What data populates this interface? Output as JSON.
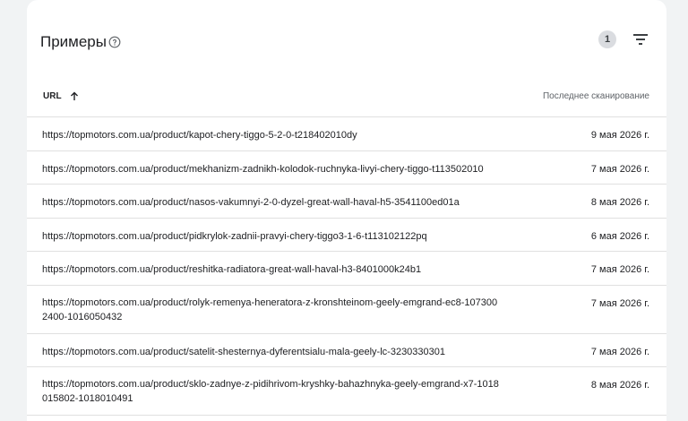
{
  "card": {
    "title": "Примеры",
    "count_badge": "1"
  },
  "table": {
    "col_url": "URL",
    "col_date": "Последнее сканирование",
    "rows": [
      {
        "url": "https://topmotors.com.ua/product/kapot-chery-tiggo-5-2-0-t218402010dy",
        "date": "9 мая 2026 г."
      },
      {
        "url": "https://topmotors.com.ua/product/mekhanizm-zadnikh-kolodok-ruchnyka-livyi-chery-tiggo-t113502010",
        "date": "7 мая 2026 г."
      },
      {
        "url": "https://topmotors.com.ua/product/nasos-vakumnyi-2-0-dyzel-great-wall-haval-h5-3541100ed01a",
        "date": "8 мая 2026 г."
      },
      {
        "url": "https://topmotors.com.ua/product/pidkrylok-zadnii-pravyi-chery-tiggo3-1-6-t113102122pq",
        "date": "6 мая 2026 г."
      },
      {
        "url": "https://topmotors.com.ua/product/reshitka-radiatora-great-wall-haval-h3-8401000k24b1",
        "date": "7 мая 2026 г."
      },
      {
        "url": "https://topmotors.com.ua/product/rolyk-remenya-heneratora-z-kronshteinom-geely-emgrand-ec8-1073002400-1016050432",
        "date": "7 мая 2026 г."
      },
      {
        "url": "https://topmotors.com.ua/product/satelit-shesternya-dyferentsialu-mala-geely-lc-3230330301",
        "date": "7 мая 2026 г."
      },
      {
        "url": "https://topmotors.com.ua/product/sklo-zadnye-z-pidihrivom-kryshky-bahazhnyka-geely-emgrand-x7-1018015802-1018010491",
        "date": "8 мая 2026 г."
      }
    ]
  }
}
